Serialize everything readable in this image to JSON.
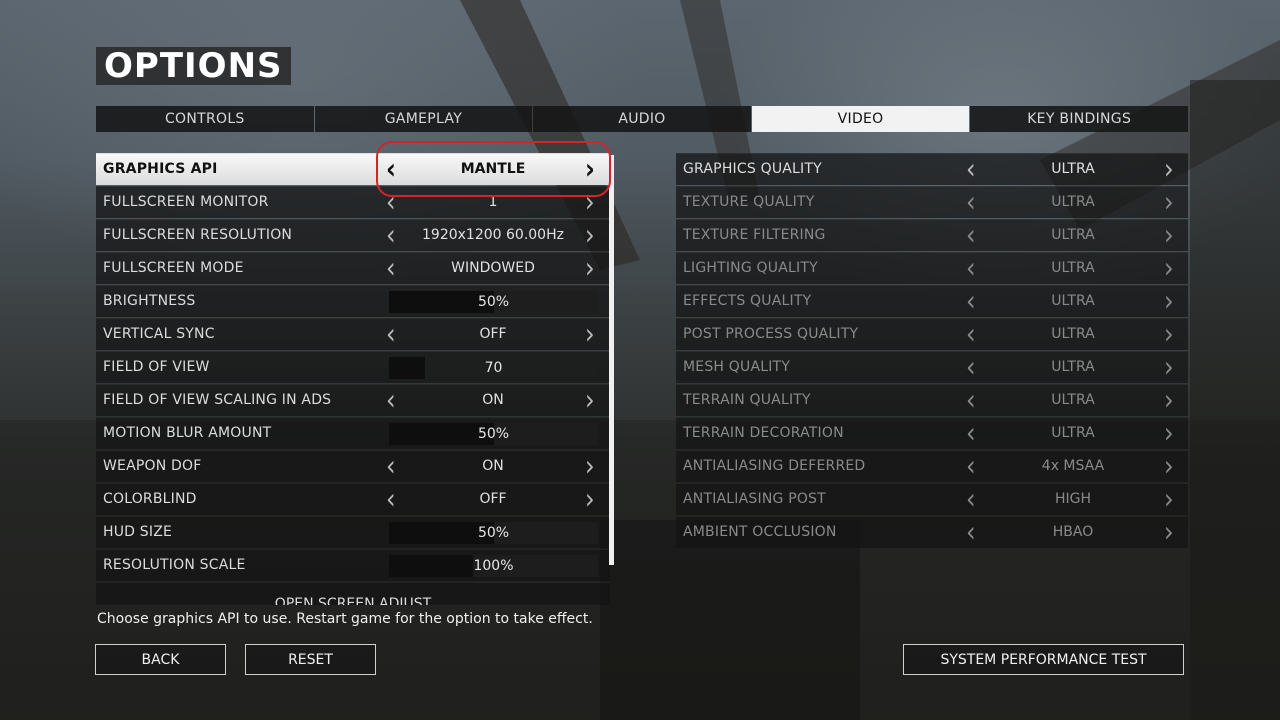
{
  "title": "OPTIONS",
  "tabs": [
    {
      "label": "CONTROLS",
      "active": false
    },
    {
      "label": "GAMEPLAY",
      "active": false
    },
    {
      "label": "AUDIO",
      "active": false
    },
    {
      "label": "VIDEO",
      "active": true
    },
    {
      "label": "KEY BINDINGS",
      "active": false
    }
  ],
  "left_settings": [
    {
      "label": "GRAPHICS API",
      "type": "select",
      "value": "MANTLE",
      "selected": true
    },
    {
      "label": "FULLSCREEN MONITOR",
      "type": "select",
      "value": "1"
    },
    {
      "label": "FULLSCREEN RESOLUTION",
      "type": "select",
      "value": "1920x1200 60.00Hz"
    },
    {
      "label": "FULLSCREEN MODE",
      "type": "select",
      "value": "WINDOWED"
    },
    {
      "label": "BRIGHTNESS",
      "type": "slider",
      "value": "50%",
      "level": 0.5
    },
    {
      "label": "VERTICAL SYNC",
      "type": "select",
      "value": "OFF"
    },
    {
      "label": "FIELD OF VIEW",
      "type": "slider",
      "value": "70",
      "level": 0.17
    },
    {
      "label": "FIELD OF VIEW SCALING IN ADS",
      "type": "select",
      "value": "ON"
    },
    {
      "label": "MOTION BLUR AMOUNT",
      "type": "slider",
      "value": "50%",
      "level": 0.5
    },
    {
      "label": "WEAPON DOF",
      "type": "select",
      "value": "ON"
    },
    {
      "label": "COLORBLIND",
      "type": "select",
      "value": "OFF"
    },
    {
      "label": "HUD SIZE",
      "type": "slider",
      "value": "50%",
      "level": 0.5
    },
    {
      "label": "RESOLUTION SCALE",
      "type": "slider",
      "value": "100%",
      "level": 0.4
    },
    {
      "label": "OPEN SCREEN ADJUST",
      "type": "action"
    }
  ],
  "right_settings": [
    {
      "label": "GRAPHICS QUALITY",
      "value": "ULTRA",
      "dim": false
    },
    {
      "label": "TEXTURE QUALITY",
      "value": "ULTRA",
      "dim": true
    },
    {
      "label": "TEXTURE FILTERING",
      "value": "ULTRA",
      "dim": true
    },
    {
      "label": "LIGHTING QUALITY",
      "value": "ULTRA",
      "dim": true
    },
    {
      "label": "EFFECTS QUALITY",
      "value": "ULTRA",
      "dim": true
    },
    {
      "label": "POST PROCESS QUALITY",
      "value": "ULTRA",
      "dim": true
    },
    {
      "label": "MESH QUALITY",
      "value": "ULTRA",
      "dim": true
    },
    {
      "label": "TERRAIN QUALITY",
      "value": "ULTRA",
      "dim": true
    },
    {
      "label": "TERRAIN DECORATION",
      "value": "ULTRA",
      "dim": true
    },
    {
      "label": "ANTIALIASING DEFERRED",
      "value": "4x MSAA",
      "dim": true
    },
    {
      "label": "ANTIALIASING POST",
      "value": "HIGH",
      "dim": true
    },
    {
      "label": "AMBIENT OCCLUSION",
      "value": "HBAO",
      "dim": true
    }
  ],
  "hint": "Choose graphics API to use. Restart game for the option to take effect.",
  "buttons": {
    "back": "BACK",
    "reset": "RESET",
    "performance_test": "SYSTEM PERFORMANCE TEST"
  },
  "arrows": {
    "left": "‹",
    "right": "›"
  },
  "colors": {
    "highlight_ring": "#d6222a",
    "active_tab": "#f2f2f2"
  }
}
